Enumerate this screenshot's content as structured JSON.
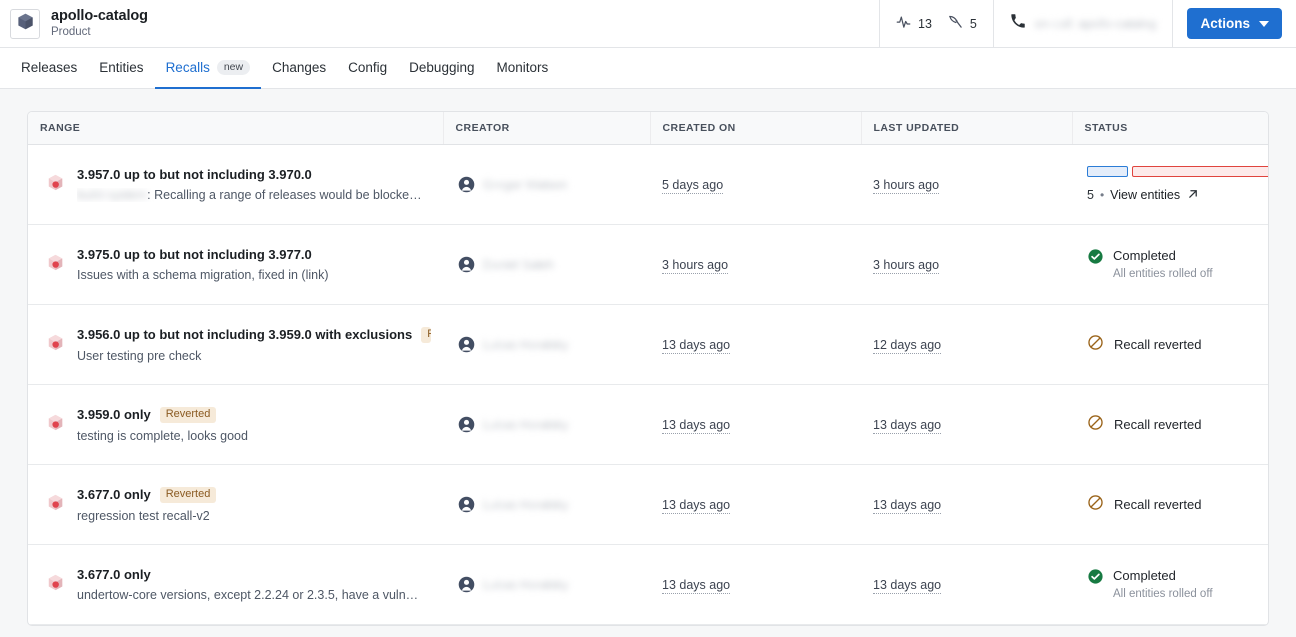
{
  "header": {
    "logo_icon": "cube-icon",
    "title": "apollo-catalog",
    "subtitle": "Product",
    "metrics": [
      {
        "icon": "activity-pulse-icon",
        "value": "13"
      },
      {
        "icon": "pickaxe-icon",
        "value": "5"
      }
    ],
    "contact": {
      "icon": "phone-icon",
      "text": "on-call: apollo-catalog"
    },
    "actions_label": "Actions"
  },
  "tabs": [
    {
      "label": "Releases",
      "active": false,
      "badge": ""
    },
    {
      "label": "Entities",
      "active": false,
      "badge": ""
    },
    {
      "label": "Recalls",
      "active": true,
      "badge": "new"
    },
    {
      "label": "Changes",
      "active": false,
      "badge": ""
    },
    {
      "label": "Config",
      "active": false,
      "badge": ""
    },
    {
      "label": "Debugging",
      "active": false,
      "badge": ""
    },
    {
      "label": "Monitors",
      "active": false,
      "badge": ""
    }
  ],
  "table": {
    "columns": [
      "RANGE",
      "CREATOR",
      "CREATED ON",
      "LAST UPDATED",
      "STATUS"
    ],
    "rows": [
      {
        "range": "3.957.0 up to but not including 3.970.0",
        "badge": "",
        "desc_blurred": "build-system",
        "desc": ": Recalling a range of releases would be blocke…",
        "creator": "Gregor Watson",
        "created_on": "5 days ago",
        "last_updated": "3 hours ago",
        "status_type": "progress",
        "status_title": "",
        "status_sub": "",
        "entity_count": "5",
        "entities_link": "View entities"
      },
      {
        "range": "3.975.0 up to but not including 3.977.0",
        "badge": "",
        "desc_blurred": "",
        "desc": "Issues with a schema migration, fixed in (link)",
        "creator": "Daniel Saleh",
        "created_on": "3 hours ago",
        "last_updated": "3 hours ago",
        "status_type": "completed",
        "status_title": "Completed",
        "status_sub": "All entities rolled off",
        "entity_count": "",
        "entities_link": ""
      },
      {
        "range": "3.956.0 up to but not including 3.959.0 with exclusions",
        "badge": "Reverted",
        "desc_blurred": "",
        "desc": "User testing pre check",
        "creator": "Lukas Horalsky",
        "created_on": "13 days ago",
        "last_updated": "12 days ago",
        "status_type": "reverted",
        "status_title": "Recall reverted",
        "status_sub": "",
        "entity_count": "",
        "entities_link": ""
      },
      {
        "range": "3.959.0 only",
        "badge": "Reverted",
        "desc_blurred": "",
        "desc": "testing is complete, looks good",
        "creator": "Lukas Horalsky",
        "created_on": "13 days ago",
        "last_updated": "13 days ago",
        "status_type": "reverted",
        "status_title": "Recall reverted",
        "status_sub": "",
        "entity_count": "",
        "entities_link": ""
      },
      {
        "range": "3.677.0 only",
        "badge": "Reverted",
        "desc_blurred": "",
        "desc": "regression test recall-v2",
        "creator": "Lukas Horalsky",
        "created_on": "13 days ago",
        "last_updated": "13 days ago",
        "status_type": "reverted",
        "status_title": "Recall reverted",
        "status_sub": "",
        "entity_count": "",
        "entities_link": ""
      },
      {
        "range": "3.677.0 only",
        "badge": "",
        "desc_blurred": "",
        "desc": "undertow-core versions, except 2.2.24 or 2.3.5, have a vuln…",
        "creator": "Lukas Horalsky",
        "created_on": "13 days ago",
        "last_updated": "13 days ago",
        "status_type": "completed",
        "status_title": "Completed",
        "status_sub": "All entities rolled off",
        "entity_count": "",
        "entities_link": ""
      }
    ]
  },
  "colors": {
    "accent": "#1f6fd0",
    "completed": "#1a7f45",
    "reverted": "#8a5a21",
    "bar_blue": "#2b7cd6",
    "bar_red": "#e0443e"
  }
}
